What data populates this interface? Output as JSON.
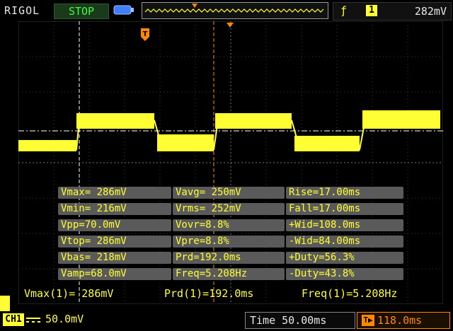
{
  "topbar": {
    "brand": "RIGOL",
    "run_state": "STOP",
    "trigger_slope_glyph": "ƒ",
    "trigger_source": "1",
    "trigger_level": "282mV"
  },
  "colors": {
    "channel1": "#ffff33",
    "trigger_marker": "#ff8800",
    "run_state": "#3cff3c",
    "grid": "#3c3c3c",
    "panel": "#5a5a5a"
  },
  "measurements": [
    [
      "Vmax= 286mV",
      "Vavg= 250mV",
      "Rise=17.00ms"
    ],
    [
      "Vmin= 216mV",
      "Vrms= 252mV",
      "Fall=17.00ms"
    ],
    [
      "Vpp=70.0mV",
      "Vovr=8.8%",
      "+Wid=108.0ms"
    ],
    [
      "Vtop= 286mV",
      "Vpre=8.8%",
      "-Wid=84.00ms"
    ],
    [
      "Vbas= 218mV",
      "Prd=192.0ms",
      "+Duty=56.3%"
    ],
    [
      "Vamp=68.0mV",
      "Freq=5.208Hz",
      "-Duty=43.8%"
    ]
  ],
  "summary": {
    "vmax": "Vmax(1)= 286mV",
    "prd": "Prd(1)=192.0ms",
    "freq": "Freq(1)=5.208Hz"
  },
  "bottombar": {
    "channel": "CH1",
    "volts_per_div": "50.0mV",
    "timebase": "Time 50.00ms",
    "trigger_delay": "118.0ms"
  },
  "icons": {
    "battery": "battery-icon",
    "trigger_marker": "trigger-marker-icon",
    "coupling": "dc-coupling-icon"
  }
}
